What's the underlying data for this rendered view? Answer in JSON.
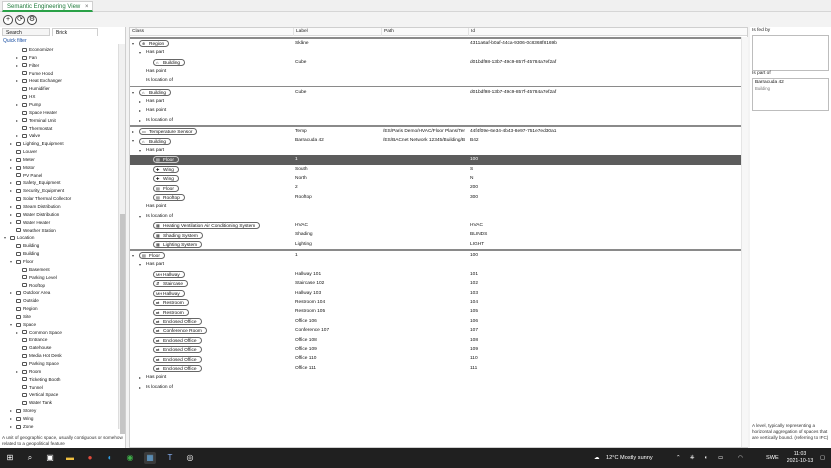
{
  "window": {
    "tab_title": "Semantic Engineering View",
    "tab_close": "×"
  },
  "toolbar": {
    "add_icon": "+",
    "refresh_icon": "⟳",
    "settings_icon": "⚙"
  },
  "left_panel": {
    "search_tab": "Search",
    "brick_tab": "Brick",
    "quick_filter": "Quick filter",
    "tree": [
      {
        "label": "Economizer",
        "level": 3,
        "exp": ""
      },
      {
        "label": "Fan",
        "level": 3,
        "exp": "▸"
      },
      {
        "label": "Filter",
        "level": 3,
        "exp": "▸"
      },
      {
        "label": "Fume Hood",
        "level": 3,
        "exp": ""
      },
      {
        "label": "Heat Exchanger",
        "level": 3,
        "exp": "▸"
      },
      {
        "label": "Humidifier",
        "level": 3,
        "exp": ""
      },
      {
        "label": "HX",
        "level": 3,
        "exp": ""
      },
      {
        "label": "Pump",
        "level": 3,
        "exp": "▸"
      },
      {
        "label": "Space Heater",
        "level": 3,
        "exp": ""
      },
      {
        "label": "Terminal Unit",
        "level": 3,
        "exp": "▸"
      },
      {
        "label": "Thermostat",
        "level": 3,
        "exp": ""
      },
      {
        "label": "Valve",
        "level": 3,
        "exp": "▸"
      },
      {
        "label": "Lighting_Equipment",
        "level": 2,
        "exp": "▸"
      },
      {
        "label": "Louver",
        "level": 2,
        "exp": ""
      },
      {
        "label": "Meter",
        "level": 2,
        "exp": "▸"
      },
      {
        "label": "Motor",
        "level": 2,
        "exp": "▸"
      },
      {
        "label": "PV Panel",
        "level": 2,
        "exp": ""
      },
      {
        "label": "Safety_Equipment",
        "level": 2,
        "exp": "▸"
      },
      {
        "label": "Security_Equipment",
        "level": 2,
        "exp": "▸"
      },
      {
        "label": "Solar Thermal Collector",
        "level": 2,
        "exp": ""
      },
      {
        "label": "Steam Distribution",
        "level": 2,
        "exp": "▸"
      },
      {
        "label": "Water Distribution",
        "level": 2,
        "exp": "▸"
      },
      {
        "label": "Water Heater",
        "level": 2,
        "exp": "▸"
      },
      {
        "label": "Weather Station",
        "level": 2,
        "exp": ""
      },
      {
        "label": "Location",
        "level": 1,
        "exp": "▾"
      },
      {
        "label": "Building",
        "level": 2,
        "exp": ""
      },
      {
        "label": "Building",
        "level": 2,
        "exp": ""
      },
      {
        "label": "Floor",
        "level": 2,
        "exp": "▾"
      },
      {
        "label": "Basement",
        "level": 3,
        "exp": ""
      },
      {
        "label": "Parking Level",
        "level": 3,
        "exp": ""
      },
      {
        "label": "Rooftop",
        "level": 3,
        "exp": ""
      },
      {
        "label": "Outdoor Area",
        "level": 2,
        "exp": "▸"
      },
      {
        "label": "Outside",
        "level": 2,
        "exp": ""
      },
      {
        "label": "Region",
        "level": 2,
        "exp": ""
      },
      {
        "label": "Site",
        "level": 2,
        "exp": ""
      },
      {
        "label": "Space",
        "level": 2,
        "exp": "▾"
      },
      {
        "label": "Common Space",
        "level": 3,
        "exp": "▸"
      },
      {
        "label": "Entrance",
        "level": 3,
        "exp": ""
      },
      {
        "label": "Gatehouse",
        "level": 3,
        "exp": ""
      },
      {
        "label": "Media Hot Desk",
        "level": 3,
        "exp": ""
      },
      {
        "label": "Parking Space",
        "level": 3,
        "exp": ""
      },
      {
        "label": "Room",
        "level": 3,
        "exp": "▸"
      },
      {
        "label": "Ticketing Booth",
        "level": 3,
        "exp": ""
      },
      {
        "label": "Tunnel",
        "level": 3,
        "exp": ""
      },
      {
        "label": "Vertical Space",
        "level": 3,
        "exp": ""
      },
      {
        "label": "Water Tank",
        "level": 3,
        "exp": ""
      },
      {
        "label": "Storey",
        "level": 2,
        "exp": "▸"
      },
      {
        "label": "Wing",
        "level": 2,
        "exp": "▸"
      },
      {
        "label": "Zone",
        "level": 2,
        "exp": "▸"
      }
    ],
    "description": "A unit of geographic space, usually contiguous or somehow related to a geopolitical feature"
  },
  "grid": {
    "columns": [
      "Class",
      "Label",
      "Path",
      "Id"
    ],
    "rows": [
      {
        "t": "sep"
      },
      {
        "t": "ent",
        "ind": 0,
        "exp": "▾",
        "icon": "⊕",
        "cls": "Region",
        "label": "Skåne",
        "path": "",
        "id": "4311a6af-b0af-44ca-9306-0c8368f8169b"
      },
      {
        "t": "grp",
        "ind": 1,
        "exp": "▾",
        "text": "Has part"
      },
      {
        "t": "ent",
        "ind": 2,
        "exp": "",
        "icon": "⌂",
        "cls": "Building",
        "label": "Cube",
        "path": "",
        "id": "d01bdf98-13b7-49c9-857f-45784a7ef2af"
      },
      {
        "t": "grp",
        "ind": 1,
        "exp": "",
        "text": "Has point"
      },
      {
        "t": "grp",
        "ind": 1,
        "exp": "",
        "text": "Is location of"
      },
      {
        "t": "sep"
      },
      {
        "t": "ent",
        "ind": 0,
        "exp": "▾",
        "icon": "⌂",
        "cls": "Building",
        "label": "Cube",
        "path": "",
        "id": "d01bdf98-13b7-49c9-857f-45784a7ef2af"
      },
      {
        "t": "grp",
        "ind": 1,
        "exp": "▸",
        "text": "Has part"
      },
      {
        "t": "grp",
        "ind": 1,
        "exp": "▸",
        "text": "Has point"
      },
      {
        "t": "grp",
        "ind": 1,
        "exp": "▸",
        "text": "Is location of"
      },
      {
        "t": "sep"
      },
      {
        "t": "ent",
        "ind": 0,
        "exp": "▸",
        "icon": "▭",
        "cls": "Temperature Sensor",
        "label": "Temp",
        "path": "/ES/Paris Demo/HVAC/Floor Plans/Ter",
        "id": "44f4f09e-6e34-4b43-8e97-751e7ed30a1"
      },
      {
        "t": "ent",
        "ind": 0,
        "exp": "▾",
        "icon": "⌂",
        "cls": "Building",
        "label": "Barracuda 42",
        "path": "/ES/BACnet Network 12345/Building/B",
        "id": "B42"
      },
      {
        "t": "grp",
        "ind": 1,
        "exp": "▾",
        "text": "Has part"
      },
      {
        "t": "ent",
        "ind": 2,
        "exp": "",
        "icon": "▤",
        "cls": "Floor",
        "label": "1",
        "path": "",
        "id": "100",
        "sel": true
      },
      {
        "t": "ent",
        "ind": 2,
        "exp": "",
        "icon": "✚",
        "cls": "Wing",
        "label": "South",
        "path": "",
        "id": "S"
      },
      {
        "t": "ent",
        "ind": 2,
        "exp": "",
        "icon": "✚",
        "cls": "Wing",
        "label": "North",
        "path": "",
        "id": "N"
      },
      {
        "t": "ent",
        "ind": 2,
        "exp": "",
        "icon": "▤",
        "cls": "Floor",
        "label": "2",
        "path": "",
        "id": "200"
      },
      {
        "t": "ent",
        "ind": 2,
        "exp": "",
        "icon": "▤",
        "cls": "Rooftop",
        "label": "Rooftop",
        "path": "",
        "id": "300"
      },
      {
        "t": "grp",
        "ind": 1,
        "exp": "",
        "text": "Has point"
      },
      {
        "t": "grp",
        "ind": 1,
        "exp": "▾",
        "text": "Is location of"
      },
      {
        "t": "ent",
        "ind": 2,
        "exp": "",
        "icon": "▦",
        "cls": "Heating Ventilation Air Conditioning System",
        "label": "HVAC",
        "path": "",
        "id": "HVAC"
      },
      {
        "t": "ent",
        "ind": 2,
        "exp": "",
        "icon": "▦",
        "cls": "Shading System",
        "label": "Shading",
        "path": "",
        "id": "BLINDS"
      },
      {
        "t": "ent",
        "ind": 2,
        "exp": "",
        "icon": "▦",
        "cls": "Lighting System",
        "label": "Lighting",
        "path": "",
        "id": "LIGHT"
      },
      {
        "t": "sep"
      },
      {
        "t": "ent",
        "ind": 0,
        "exp": "▾",
        "icon": "▤",
        "cls": "Floor",
        "label": "1",
        "path": "",
        "id": "100"
      },
      {
        "t": "grp",
        "ind": 1,
        "exp": "▾",
        "text": "Has part"
      },
      {
        "t": "ent",
        "ind": 2,
        "exp": "",
        "icon": "MH",
        "cls": "Hallway",
        "label": "Hallway 101",
        "path": "",
        "id": "101"
      },
      {
        "t": "ent",
        "ind": 2,
        "exp": "",
        "icon": "⇵",
        "cls": "Staircase",
        "label": "Staircase 102",
        "path": "",
        "id": "102"
      },
      {
        "t": "ent",
        "ind": 2,
        "exp": "",
        "icon": "MH",
        "cls": "Hallway",
        "label": "Hallway 103",
        "path": "",
        "id": "103"
      },
      {
        "t": "ent",
        "ind": 2,
        "exp": "",
        "icon": "⇄",
        "cls": "Restroom",
        "label": "Restroom 104",
        "path": "",
        "id": "104"
      },
      {
        "t": "ent",
        "ind": 2,
        "exp": "",
        "icon": "⇄",
        "cls": "Restroom",
        "label": "Restroom 105",
        "path": "",
        "id": "105"
      },
      {
        "t": "ent",
        "ind": 2,
        "exp": "",
        "icon": "⇄",
        "cls": "Enclosed Office",
        "label": "Office 106",
        "path": "",
        "id": "106"
      },
      {
        "t": "ent",
        "ind": 2,
        "exp": "",
        "icon": "⇄",
        "cls": "Conference Room",
        "label": "Conference 107",
        "path": "",
        "id": "107"
      },
      {
        "t": "ent",
        "ind": 2,
        "exp": "",
        "icon": "⇄",
        "cls": "Enclosed Office",
        "label": "Office 108",
        "path": "",
        "id": "108"
      },
      {
        "t": "ent",
        "ind": 2,
        "exp": "",
        "icon": "⇄",
        "cls": "Enclosed Office",
        "label": "Office 109",
        "path": "",
        "id": "109"
      },
      {
        "t": "ent",
        "ind": 2,
        "exp": "",
        "icon": "⇄",
        "cls": "Enclosed Office",
        "label": "Office 110",
        "path": "",
        "id": "110"
      },
      {
        "t": "ent",
        "ind": 2,
        "exp": "",
        "icon": "⇄",
        "cls": "Enclosed Office",
        "label": "Office 111",
        "path": "",
        "id": "111"
      },
      {
        "t": "grp",
        "ind": 1,
        "exp": "▸",
        "text": "Has point"
      },
      {
        "t": "grp",
        "ind": 1,
        "exp": "▸",
        "text": "Is location of"
      }
    ]
  },
  "right_panel": {
    "is_fed_by": "Is fed by",
    "is_part_of": "Is part of",
    "part_of_item": "Barracuda 42",
    "part_of_sub": "Building",
    "description": "A level, typically representing a horizontal aggregation of spaces that are vertically bound. (referring to IFC)"
  },
  "taskbar": {
    "weather": "12°C  Mostly sunny",
    "lang": "SWE",
    "time": "11:03",
    "date": "2021-10-13"
  },
  "colors": {
    "accent": "#2aa148",
    "selected_row": "#5c5c5c",
    "taskbar": "#202020"
  }
}
